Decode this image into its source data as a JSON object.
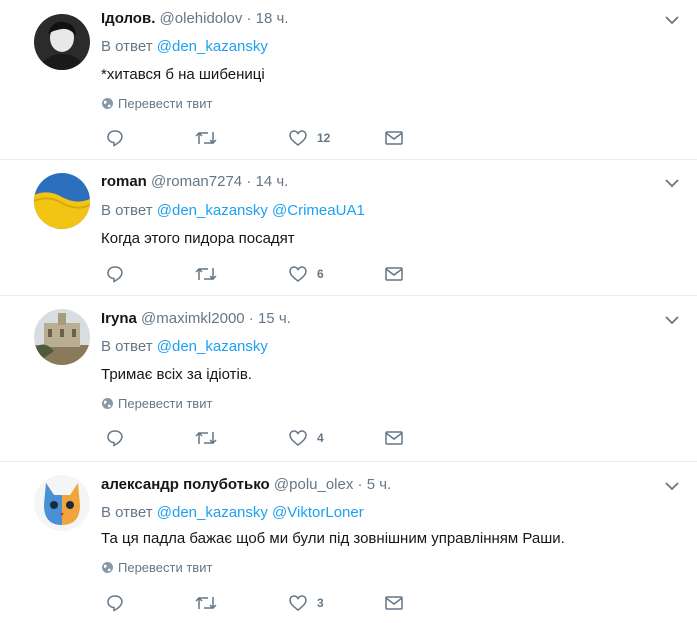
{
  "tweets": [
    {
      "name": "Ідолов.",
      "handle": "@olehidolov",
      "dot": "·",
      "time": "18 ч.",
      "reply_prefix": "В ответ",
      "mentions": [
        "@den_kazansky"
      ],
      "text": "*хитався б на шибениці",
      "translate": "Перевести твит",
      "likes": "12",
      "avatar_icon": "person-photo-icon"
    },
    {
      "name": "roman",
      "handle": "@roman7274",
      "dot": "·",
      "time": "14 ч.",
      "reply_prefix": "В ответ",
      "mentions": [
        "@den_kazansky",
        "@CrimeaUA1"
      ],
      "text": "Когда этого пидора посадят",
      "translate": "",
      "likes": "6",
      "avatar_icon": "ukraine-flag-icon"
    },
    {
      "name": "Iryna",
      "handle": "@maximkl2000",
      "dot": "·",
      "time": "15 ч.",
      "reply_prefix": "В ответ",
      "mentions": [
        "@den_kazansky"
      ],
      "text": "Тримає всіх за ідіотів.",
      "translate": "Перевести твит",
      "likes": "4",
      "avatar_icon": "building-photo-icon"
    },
    {
      "name": "александр полуботько",
      "handle": "@polu_olex",
      "dot": "·",
      "time": "5 ч.",
      "reply_prefix": "В ответ",
      "mentions": [
        "@den_kazansky",
        "@ViktorLoner"
      ],
      "text": "Та ця падла бажає щоб ми були під зовнішним управлінням Раши.",
      "translate": "Перевести твит",
      "likes": "3",
      "avatar_icon": "cat-icon"
    }
  ],
  "colors": {
    "link": "#1da1f2",
    "muted": "#657786",
    "text": "#14171a",
    "divider": "#e6ecf0"
  }
}
